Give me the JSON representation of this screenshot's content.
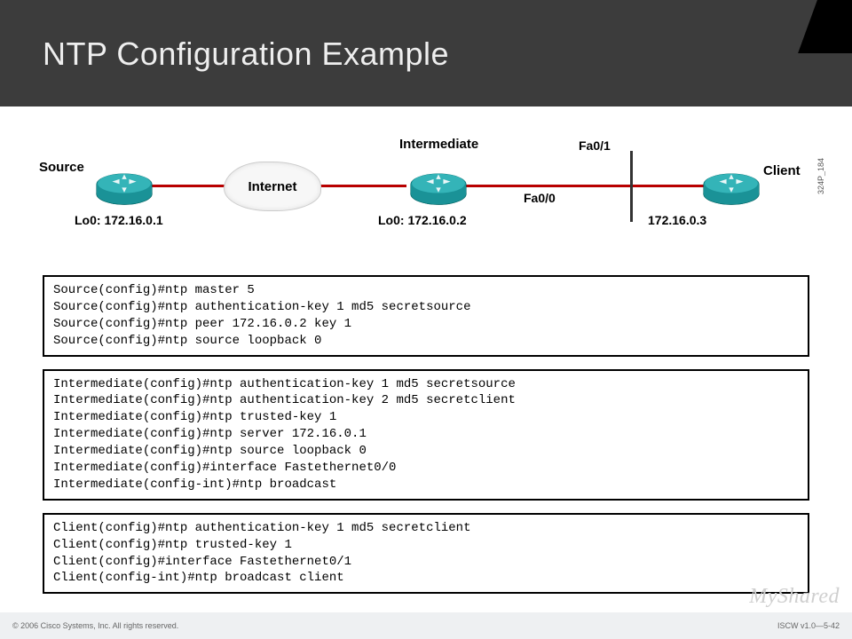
{
  "title": "NTP Configuration Example",
  "diagram": {
    "source_label": "Source",
    "source_sub": "Lo0: 172.16.0.1",
    "internet_label": "Internet",
    "intermediate_label": "Intermediate",
    "intermediate_sub": "Lo0: 172.16.0.2",
    "if_fa00": "Fa0/0",
    "if_fa01": "Fa0/1",
    "client_label": "Client",
    "client_ip": "172.16.0.3",
    "side_marker": "324P_184"
  },
  "code": {
    "source": "Source(config)#ntp master 5\nSource(config)#ntp authentication-key 1 md5 secretsource\nSource(config)#ntp peer 172.16.0.2 key 1\nSource(config)#ntp source loopback 0",
    "intermediate": "Intermediate(config)#ntp authentication-key 1 md5 secretsource\nIntermediate(config)#ntp authentication-key 2 md5 secretclient\nIntermediate(config)#ntp trusted-key 1\nIntermediate(config)#ntp server 172.16.0.1\nIntermediate(config)#ntp source loopback 0\nIntermediate(config)#interface Fastethernet0/0\nIntermediate(config-int)#ntp broadcast",
    "client": "Client(config)#ntp authentication-key 1 md5 secretclient\nClient(config)#ntp trusted-key 1\nClient(config)#interface Fastethernet0/1\nClient(config-int)#ntp broadcast client"
  },
  "footer": {
    "left": "© 2006 Cisco Systems, Inc. All rights reserved.",
    "right": "ISCW v1.0—5-42"
  },
  "watermark": "MyShared"
}
